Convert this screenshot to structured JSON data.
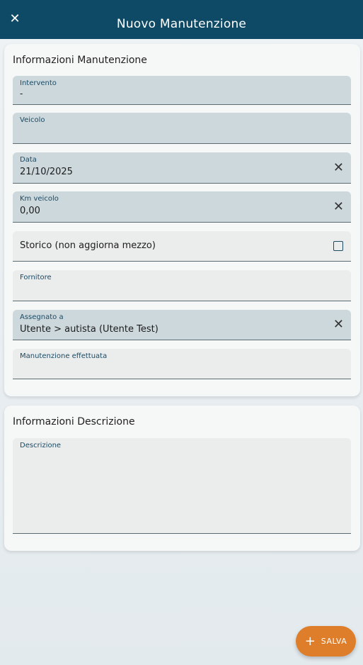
{
  "header": {
    "close_icon": "✕",
    "title": "Nuovo Manutenzione"
  },
  "info_card": {
    "title": "Informazioni Manutenzione",
    "fields": {
      "intervento": {
        "label": "Intervento",
        "value": "-"
      },
      "veicolo": {
        "label": "Veicolo",
        "value": ""
      },
      "data": {
        "label": "Data",
        "value": "21/10/2025"
      },
      "km": {
        "label": "Km veicolo",
        "value": "0,00"
      },
      "storico": {
        "label": "Storico (non aggiorna mezzo)",
        "checked": false
      },
      "fornitore": {
        "label": "Fornitore",
        "value": ""
      },
      "assegnato": {
        "label": "Assegnato a",
        "value": "Utente > autista (Utente Test)"
      },
      "effettuata": {
        "label": "Manutenzione effettuata",
        "value": ""
      }
    },
    "clear_icon": "✕"
  },
  "desc_card": {
    "title": "Informazioni Descrizione",
    "fields": {
      "descrizione": {
        "label": "Descrizione",
        "value": ""
      }
    }
  },
  "fab": {
    "icon": "+",
    "label": "SALVA",
    "color": "#de7e2a"
  },
  "colors": {
    "header_bg": "#0e4a66",
    "field_filled_bg": "#cdd8dd",
    "field_empty_bg": "#ebecec",
    "label_color": "#1b4a62"
  }
}
